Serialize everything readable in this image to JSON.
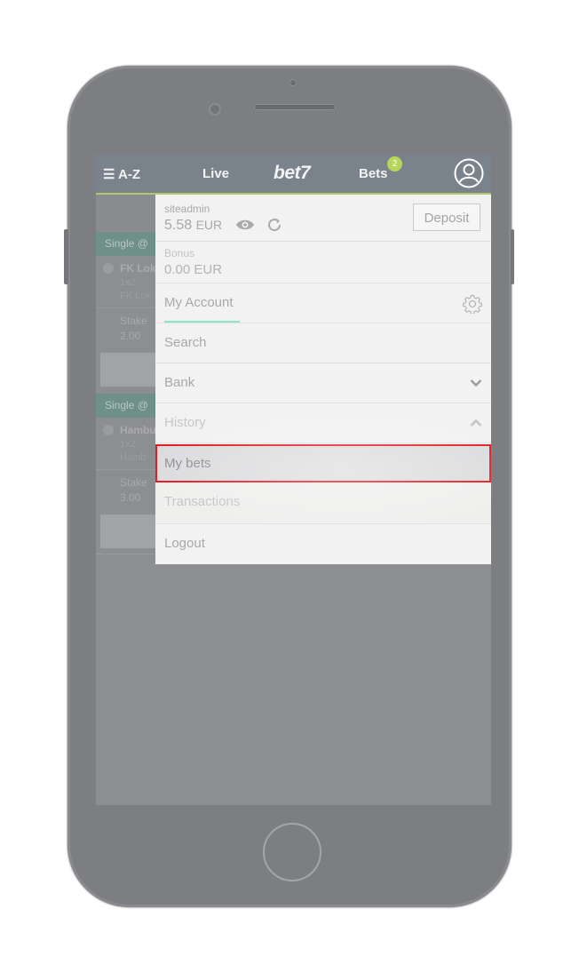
{
  "header": {
    "menu_label": "☰ A-Z",
    "live_label": "Live",
    "logo_text": "bet7",
    "bets_label": "Bets",
    "bets_count": "2",
    "accent_color": "#b5d65a"
  },
  "account": {
    "username": "siteadmin",
    "balance_amount": "5.58",
    "balance_currency": "EUR",
    "deposit_label": "Deposit",
    "bonus_label": "Bonus",
    "bonus_amount": "0.00 EUR"
  },
  "menu": {
    "items": [
      {
        "label": "My Account",
        "icon": "gear-icon"
      },
      {
        "label": "Search"
      },
      {
        "label": "Bank",
        "icon": "chevron-down-icon"
      },
      {
        "label": "History",
        "icon": "chevron-up-icon"
      },
      {
        "label": "My bets",
        "selected": true
      },
      {
        "label": "Transactions"
      },
      {
        "label": "Logout"
      }
    ]
  },
  "betslip": {
    "bets": [
      {
        "header": "Single @",
        "event": "FK Lok",
        "market": "1x2",
        "selection": "FK Lok",
        "stake_label": "Stake",
        "stake": "2.00"
      },
      {
        "header": "Single @",
        "event": "Hambu",
        "market": "1x2",
        "selection": "Hamb",
        "stake_label": "Stake",
        "stake": "3.00"
      }
    ]
  }
}
